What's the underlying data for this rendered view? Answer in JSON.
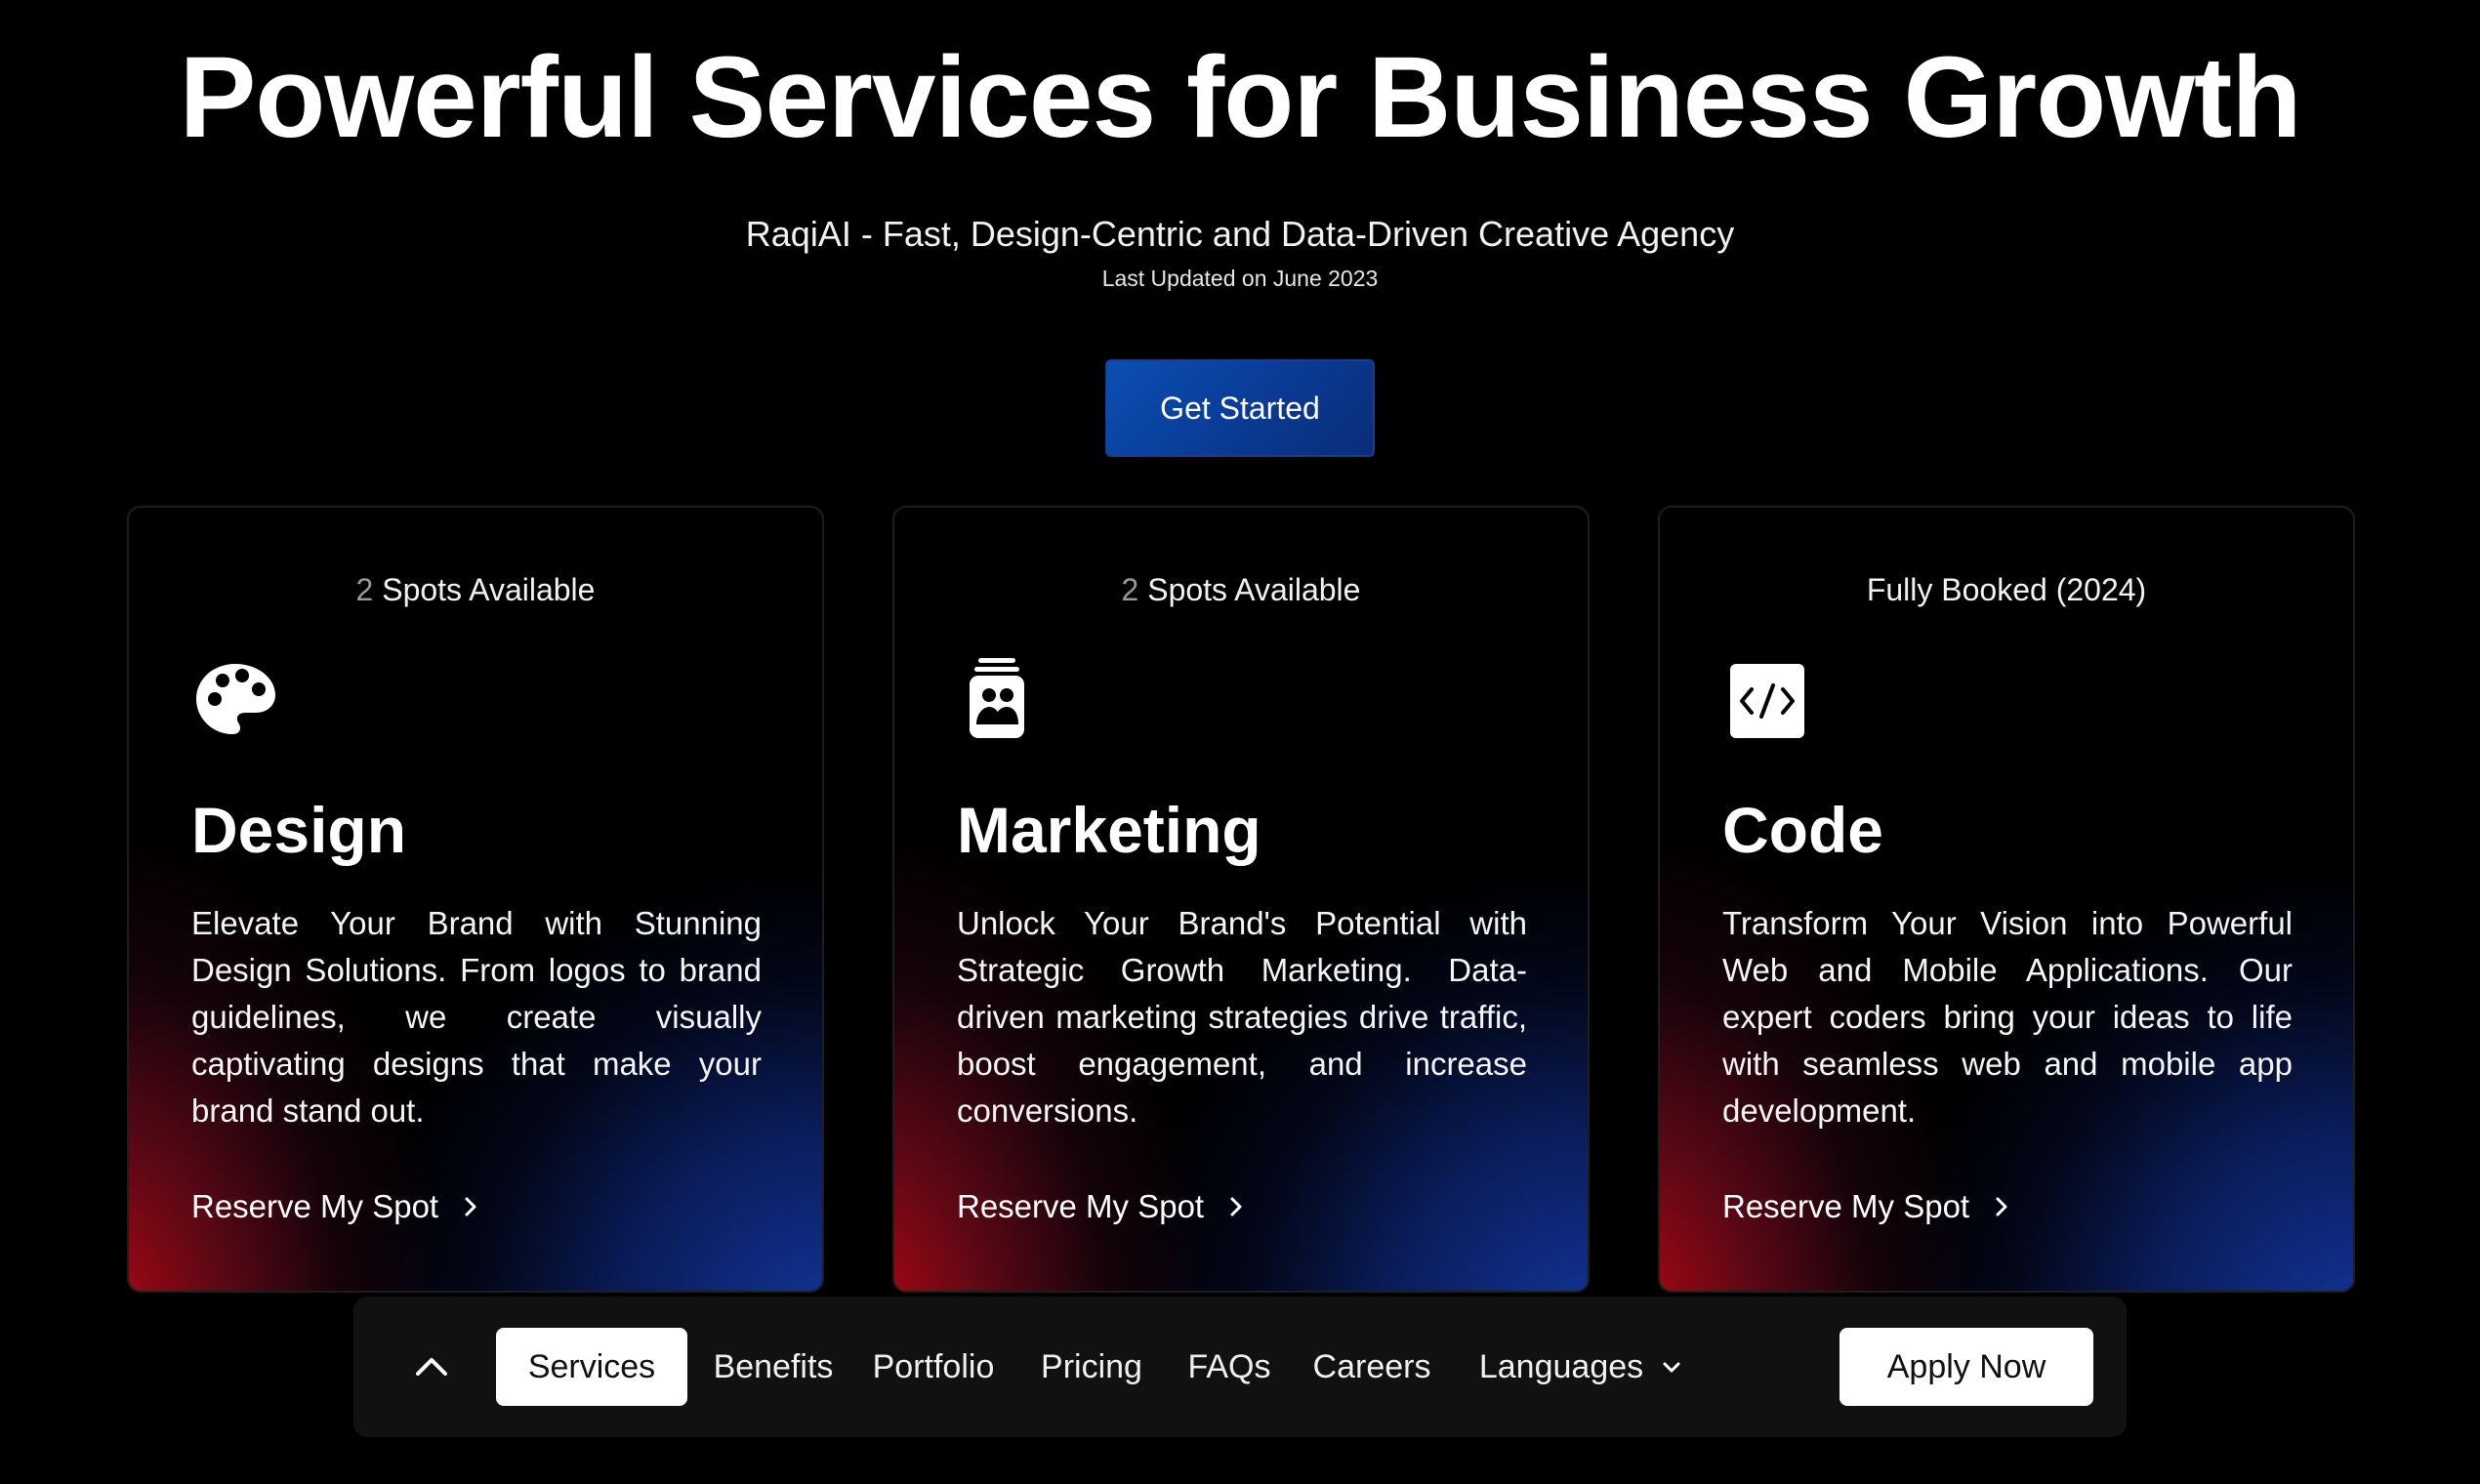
{
  "hero": {
    "title": "Powerful Services for Business Growth",
    "subtitle": "RaqiAI - Fast, Design-Centric and Data-Driven Creative Agency",
    "updated": "Last Updated on June 2023",
    "cta_label": "Get Started"
  },
  "cards": [
    {
      "status_number": "2",
      "status_text": " Spots Available",
      "icon": "palette-icon",
      "title": "Design",
      "description": "Elevate Your Brand with Stunning Design Solutions. From logos to brand guidelines, we create visually captivating designs that make your brand stand out.",
      "link_label": "Reserve My Spot"
    },
    {
      "status_number": "2",
      "status_text": " Spots Available",
      "icon": "marketing-jar-icon",
      "title": "Marketing",
      "description": "Unlock Your Brand's Potential with Strategic Growth Marketing. Data-driven marketing strategies drive traffic, boost engagement, and increase conversions.",
      "link_label": "Reserve My Spot"
    },
    {
      "status_text": "Fully Booked (2024)",
      "icon": "code-icon",
      "title": "Code",
      "description": "Transform Your Vision into Powerful Web and Mobile Applications. Our expert coders bring your ideas to life with seamless web and mobile app development.",
      "link_label": "Reserve My Spot"
    }
  ],
  "nav": {
    "items": [
      {
        "label": "Services",
        "active": true
      },
      {
        "label": "Benefits"
      },
      {
        "label": "Portfolio"
      },
      {
        "label": "Pricing"
      },
      {
        "label": "FAQs"
      },
      {
        "label": "Careers"
      },
      {
        "label": "Languages"
      }
    ],
    "apply_label": "Apply Now"
  },
  "colors": {
    "background": "#000000",
    "accent_blue": "#0b4fb3",
    "gradient_red": "#be0814",
    "gradient_blue": "#1437a0",
    "navbar": "#111111"
  }
}
